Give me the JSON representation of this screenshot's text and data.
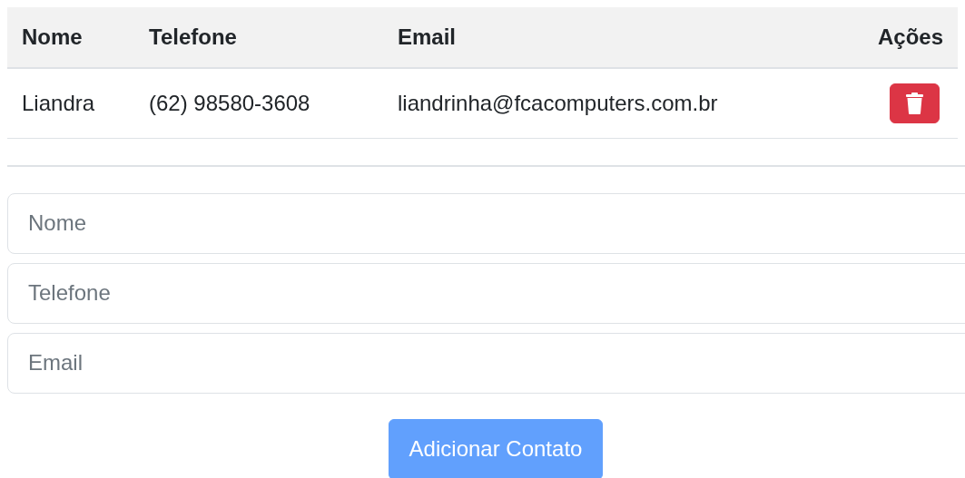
{
  "table": {
    "columns": [
      "Nome",
      "Telefone",
      "Email",
      "Ações"
    ],
    "rows": [
      {
        "nome": "Liandra",
        "telefone": "(62) 98580-3608",
        "email": "liandrinha@fcacomputers.com.br"
      }
    ]
  },
  "form": {
    "fields": [
      {
        "placeholder": "Nome"
      },
      {
        "placeholder": "Telefone"
      },
      {
        "placeholder": "Email"
      }
    ],
    "submit": {
      "label": "Adicionar Contato",
      "disabled": true
    }
  }
}
